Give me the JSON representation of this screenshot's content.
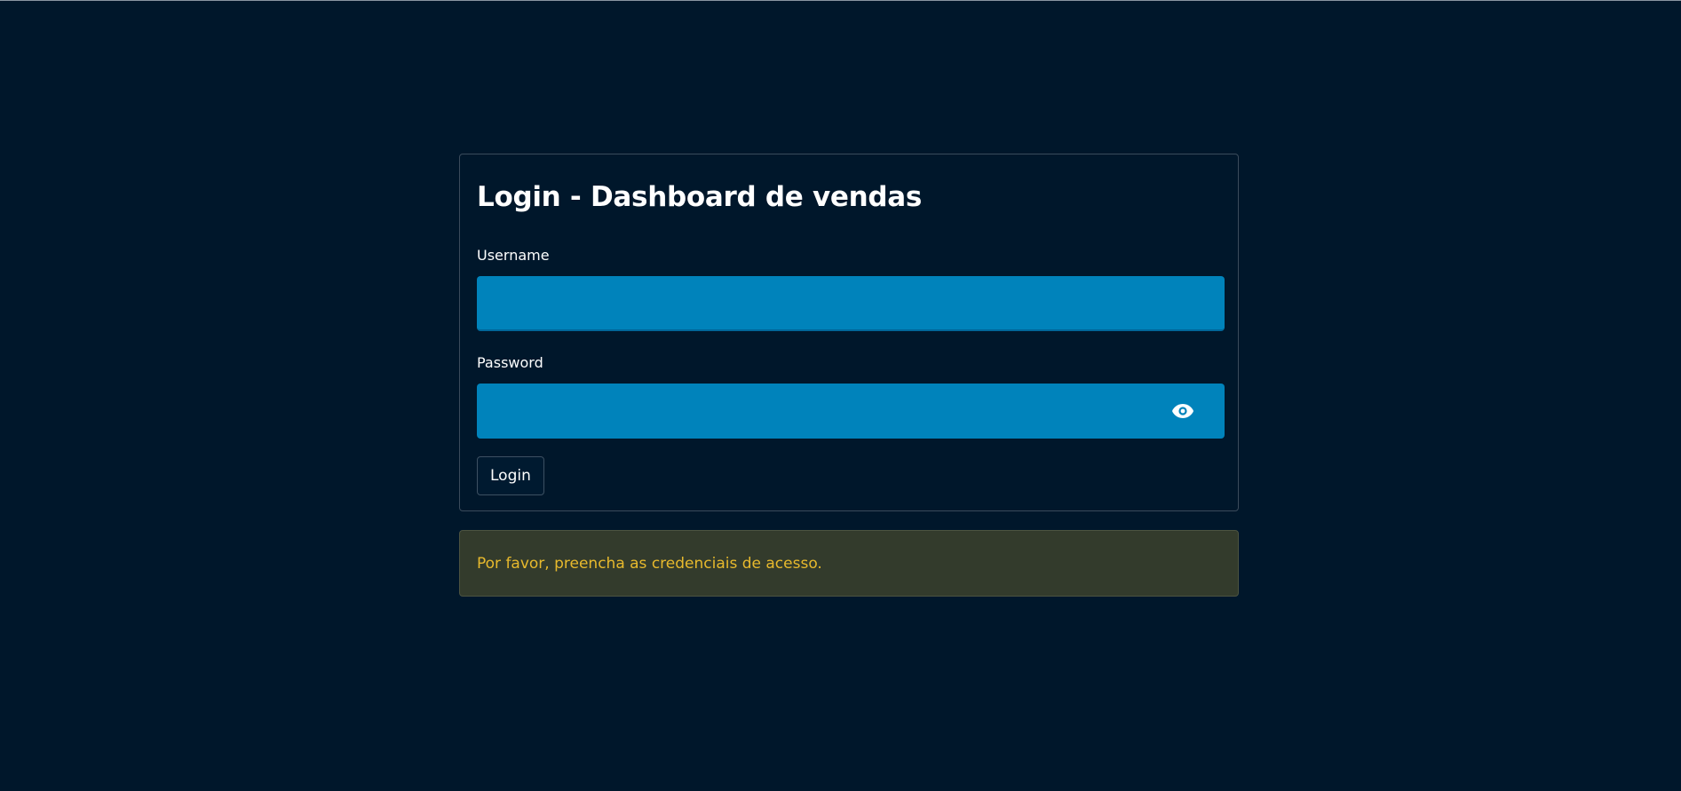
{
  "form": {
    "title": "Login - Dashboard de vendas",
    "username": {
      "label": "Username",
      "value": ""
    },
    "password": {
      "label": "Password",
      "value": "",
      "toggle_icon": "eye-icon"
    },
    "submit_label": "Login"
  },
  "alert": {
    "text": "Por favor, preencha as credenciais de acesso.",
    "type": "warning"
  },
  "colors": {
    "background": "#00172b",
    "input_fill": "#0083bb",
    "alert_background": "#333b2c",
    "alert_text": "#e7b92d"
  }
}
